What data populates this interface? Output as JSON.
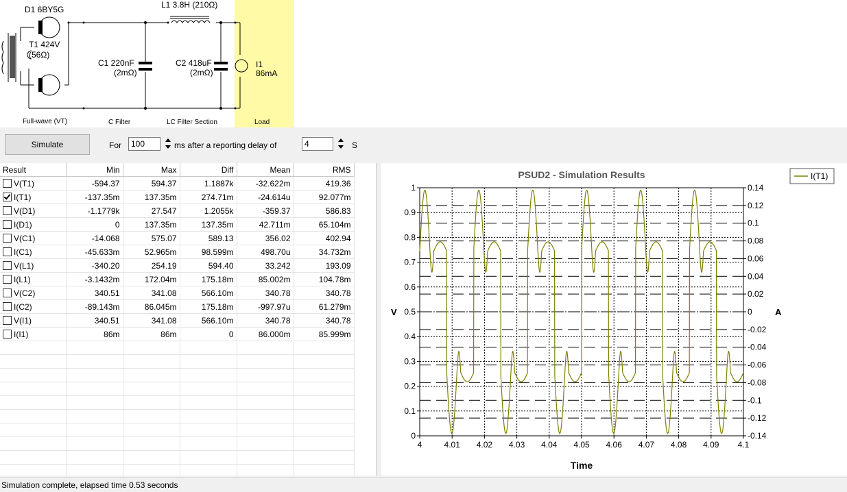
{
  "schematic": {
    "d1_label": "D1 6BY5G",
    "t1_label_1": "T1 424V",
    "t1_label_2": "(56Ω)",
    "l1_label": "L1 3.8H (210Ω)",
    "c1_label_1": "C1 220nF",
    "c1_label_2": "(2mΩ)",
    "c2_label_1": "C2 418uF",
    "c2_label_2": "(2mΩ)",
    "i1_label_1": "I1",
    "i1_label_2": "86mA",
    "section_fullwave": "Full-wave (VT)",
    "section_cfilter": "C Filter",
    "section_lc": "LC Filter Section",
    "section_load": "Load"
  },
  "toolbar": {
    "simulate_label": "Simulate",
    "for_label": "For",
    "duration_value": "100",
    "ms_label": "ms  after a reporting delay of",
    "delay_value": "4",
    "s_label": "S"
  },
  "results": {
    "headers": [
      "Result",
      "Min",
      "Max",
      "Diff",
      "Mean",
      "RMS"
    ],
    "rows": [
      {
        "name": "V(T1)",
        "checked": false,
        "min": "-594.37",
        "max": "594.37",
        "diff": "1.1887k",
        "mean": "-32.622m",
        "rms": "419.36"
      },
      {
        "name": "I(T1)",
        "checked": true,
        "min": "-137.35m",
        "max": "137.35m",
        "diff": "274.71m",
        "mean": "-24.614u",
        "rms": "92.077m"
      },
      {
        "name": "V(D1)",
        "checked": false,
        "min": "-1.1779k",
        "max": "27.547",
        "diff": "1.2055k",
        "mean": "-359.37",
        "rms": "586.83"
      },
      {
        "name": "I(D1)",
        "checked": false,
        "min": "0",
        "max": "137.35m",
        "diff": "137.35m",
        "mean": "42.711m",
        "rms": "65.104m"
      },
      {
        "name": "V(C1)",
        "checked": false,
        "min": "-14.068",
        "max": "575.07",
        "diff": "589.13",
        "mean": "356.02",
        "rms": "402.94"
      },
      {
        "name": "I(C1)",
        "checked": false,
        "min": "-45.633m",
        "max": "52.965m",
        "diff": "98.599m",
        "mean": "498.70u",
        "rms": "34.732m"
      },
      {
        "name": "V(L1)",
        "checked": false,
        "min": "-340.20",
        "max": "254.19",
        "diff": "594.40",
        "mean": "33.242",
        "rms": "193.09"
      },
      {
        "name": "I(L1)",
        "checked": false,
        "min": "-3.1432m",
        "max": "172.04m",
        "diff": "175.18m",
        "mean": "85.002m",
        "rms": "104.78m"
      },
      {
        "name": "V(C2)",
        "checked": false,
        "min": "340.51",
        "max": "341.08",
        "diff": "566.10m",
        "mean": "340.78",
        "rms": "340.78"
      },
      {
        "name": "I(C2)",
        "checked": false,
        "min": "-89.143m",
        "max": "86.045m",
        "diff": "175.18m",
        "mean": "-997.97u",
        "rms": "61.279m"
      },
      {
        "name": "V(I1)",
        "checked": false,
        "min": "340.51",
        "max": "341.08",
        "diff": "566.10m",
        "mean": "340.78",
        "rms": "340.78"
      },
      {
        "name": "I(I1)",
        "checked": false,
        "min": "86m",
        "max": "86m",
        "diff": "0",
        "mean": "86.000m",
        "rms": "85.999m"
      }
    ]
  },
  "chart_data": {
    "type": "line",
    "title": "PSUD2 - Simulation Results",
    "xlabel": "Time",
    "ylabel_left": "V",
    "ylabel_right": "A",
    "xlim": [
      4,
      4.1
    ],
    "ylim_left": [
      0,
      1
    ],
    "ylim_right": [
      -0.14,
      0.14
    ],
    "x_ticks": [
      "4",
      "4.01",
      "4.02",
      "4.03",
      "4.04",
      "4.05",
      "4.06",
      "4.07",
      "4.08",
      "4.09",
      "4.1"
    ],
    "y_left_ticks": [
      "0",
      "0.1",
      "0.2",
      "0.3",
      "0.4",
      "0.5",
      "0.6",
      "0.7",
      "0.8",
      "0.9",
      "1"
    ],
    "y_right_ticks": [
      "0.14",
      "0.12",
      "0.1",
      "0.08",
      "0.06",
      "0.04",
      "0.02",
      "0",
      "-0.02",
      "-0.04",
      "-0.06",
      "-0.08",
      "-0.1",
      "-0.12",
      "-0.14"
    ],
    "grid": true,
    "legend_position": "top-right",
    "series": [
      {
        "name": "I(T1)",
        "axis": "right",
        "color": "#808000",
        "period": 0.016667,
        "peak": 0.13735,
        "note_shape": "half-wave positive then negative current pulses"
      }
    ]
  },
  "status": {
    "text": "Simulation complete, elapsed time 0.53 seconds"
  }
}
